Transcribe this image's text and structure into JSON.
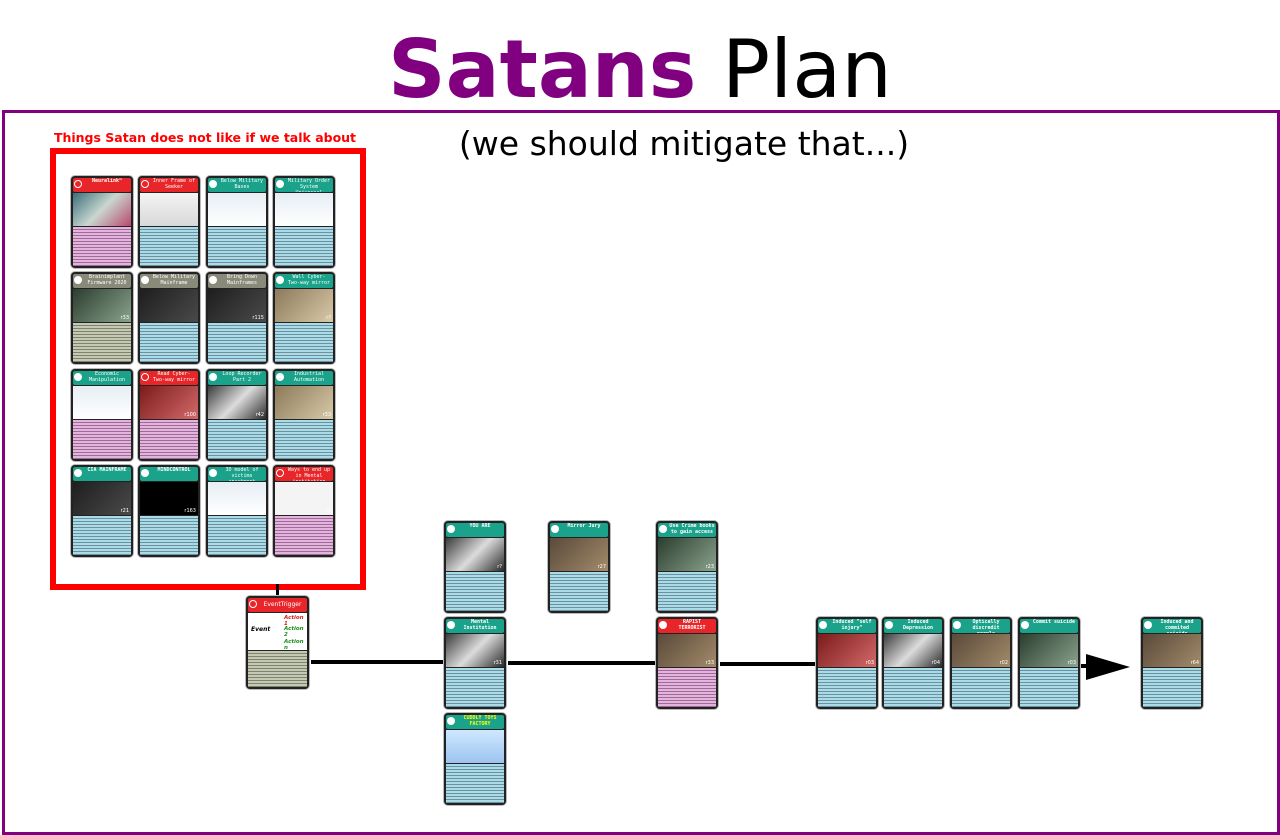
{
  "title": {
    "part1": "Satans",
    "part2": "Plan"
  },
  "subtitle": "(we should mitigate that...)",
  "grid_label": "Things Satan does not like if we talk about",
  "colors": {
    "purple": "#800080",
    "red": "#ff0000",
    "card_teal": "#1aa38a",
    "card_red": "#e8262a"
  },
  "grid_cards": [
    {
      "title": "Neuralink™",
      "color": "red",
      "pic": "neur",
      "body": "pink",
      "num": ""
    },
    {
      "title": "Inner Frame of Seeker",
      "color": "red",
      "pic": "cam",
      "body": "blue",
      "num": ""
    },
    {
      "title": "Below Military Bases",
      "color": "teal",
      "pic": "web",
      "body": "blue",
      "num": ""
    },
    {
      "title": "Military Order System Universal",
      "color": "teal",
      "pic": "web",
      "body": "blue",
      "num": ""
    },
    {
      "title": "Brainimplant Firmware 2020",
      "color": "grey",
      "pic": "shot",
      "body": "grey",
      "num": "r33"
    },
    {
      "title": "Below Military Mainframe",
      "color": "grey",
      "pic": "dark",
      "body": "blue",
      "num": ""
    },
    {
      "title": "Bring Down Mainframes",
      "color": "grey",
      "pic": "dark",
      "body": "blue",
      "num": "r115"
    },
    {
      "title": "Wall Cyber- Two-way mirror",
      "color": "teal",
      "pic": "room",
      "body": "blue",
      "num": "r?"
    },
    {
      "title": "Economic Manipulation",
      "color": "teal",
      "pic": "web",
      "body": "pink",
      "num": ""
    },
    {
      "title": "Read Cyber- Two-way mirror",
      "color": "red",
      "pic": "blood",
      "body": "pink",
      "num": "r100"
    },
    {
      "title": "Loop Recorder Part 2",
      "color": "teal",
      "pic": "bw",
      "body": "blue",
      "num": "r42"
    },
    {
      "title": "Industrial Automation",
      "color": "teal",
      "pic": "room",
      "body": "blue",
      "num": "r33"
    },
    {
      "title": "CIA MAINFRAME",
      "color": "teal",
      "pic": "dark",
      "body": "blue",
      "num": "r21"
    },
    {
      "title": "MINDCONTROL",
      "color": "teal",
      "pic": "code",
      "body": "blue",
      "num": "r163"
    },
    {
      "title": "3D model of victims apartment",
      "color": "teal",
      "pic": "web",
      "body": "blue",
      "num": "r43"
    },
    {
      "title": "Ways to end up in Mental institution",
      "color": "red",
      "pic": "white",
      "body": "pink",
      "num": "r?"
    }
  ],
  "event_card": {
    "title": "EventTrigger",
    "event": "Event",
    "actions": [
      "Action 1",
      "Action 2",
      "Action n"
    ]
  },
  "flow_cards": [
    {
      "id": "you-are",
      "title": "YOU ARE",
      "pic": "bw",
      "body": "blue",
      "num": "r?"
    },
    {
      "id": "mental",
      "title": "Mental Institution",
      "pic": "bw",
      "body": "blue",
      "num": "r31"
    },
    {
      "id": "cuddly",
      "title": "CUDDLY TOYS FACTORY",
      "pic": "cyan",
      "body": "blue",
      "num": ""
    },
    {
      "id": "mirror-jury",
      "title": "Mirror Jury",
      "pic": "photo",
      "body": "blue",
      "num": "r27"
    },
    {
      "id": "crime-books",
      "title": "Use Crime books to gain access",
      "pic": "shot",
      "body": "blue",
      "num": "r23"
    },
    {
      "id": "rapist",
      "title": "RAPIST TERRORIST",
      "pic": "photo",
      "body": "pink",
      "num": "r33"
    },
    {
      "id": "self-injury",
      "title": "Induced \"self injury\"",
      "pic": "blood",
      "body": "blue",
      "num": "r03"
    },
    {
      "id": "depression",
      "title": "Induced Depression",
      "pic": "bw",
      "body": "blue",
      "num": "r04"
    },
    {
      "id": "discredit",
      "title": "Optically discredit people",
      "pic": "photo",
      "body": "blue",
      "num": "r02"
    },
    {
      "id": "suicide",
      "title": "Commit suicide",
      "pic": "shot",
      "body": "blue",
      "num": "r03"
    },
    {
      "id": "induced-suicide",
      "title": "Induced and commited suicide",
      "pic": "photo",
      "body": "blue",
      "num": "r64"
    }
  ]
}
